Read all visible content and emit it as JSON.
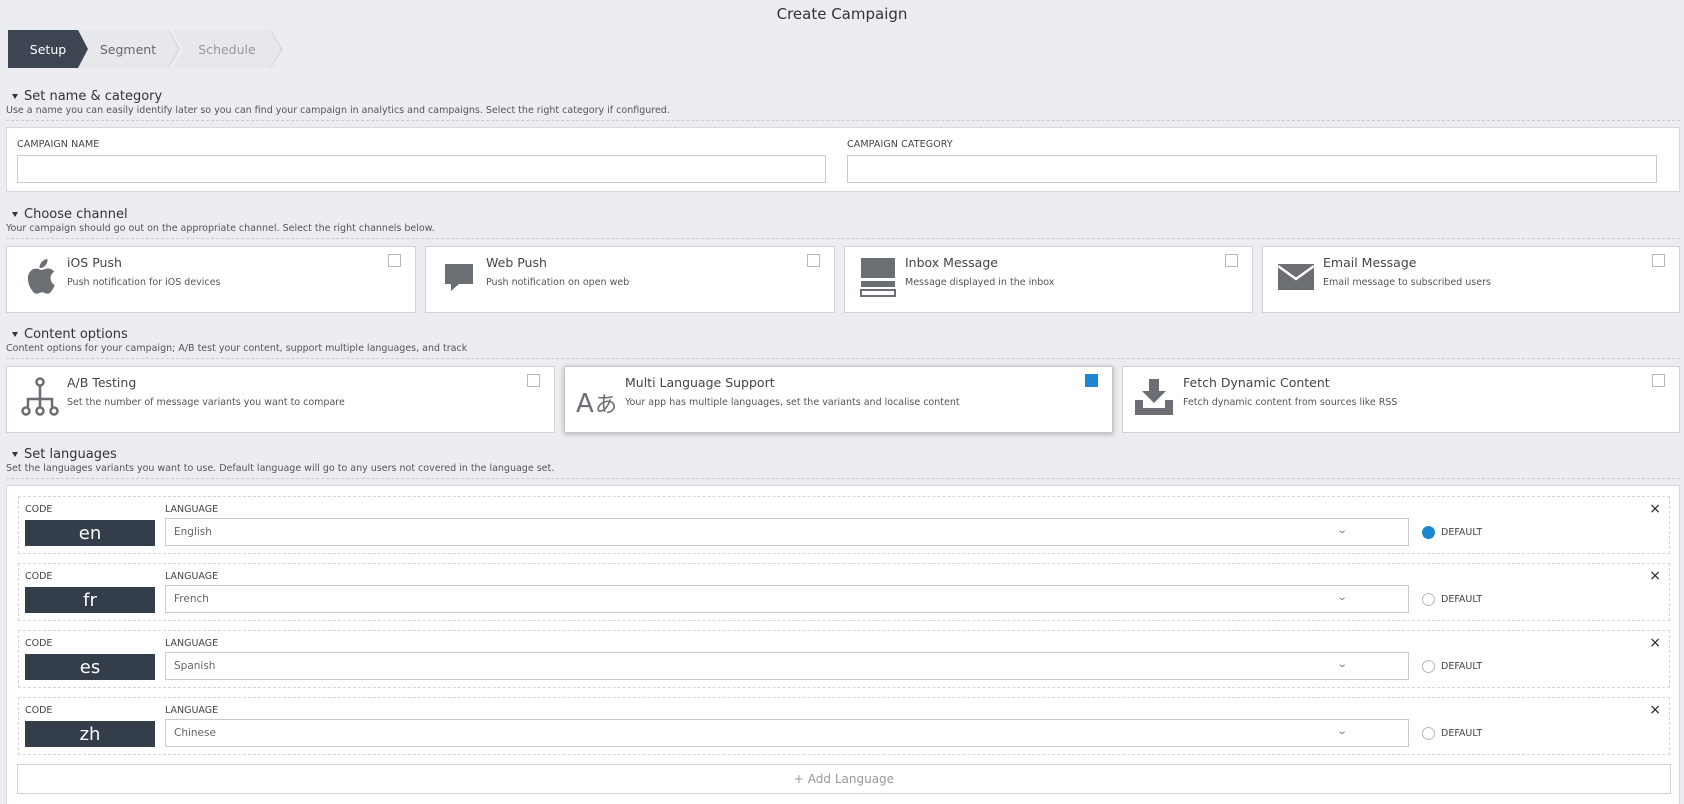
{
  "page": {
    "title": "Create Campaign"
  },
  "wizard": {
    "steps": [
      {
        "label": "Setup"
      },
      {
        "label": "Segment"
      },
      {
        "label": "Schedule"
      }
    ]
  },
  "sections": {
    "name": {
      "title": "Set name & category",
      "desc": "Use a name you can easily identify later so you can find your campaign in analytics and campaigns. Select the right category if configured.",
      "campaign_name_label": "CAMPAIGN NAME",
      "campaign_name_value": "",
      "campaign_category_label": "CAMPAIGN CATEGORY",
      "campaign_category_value": ""
    },
    "channel": {
      "title": "Choose channel",
      "desc": "Your campaign should go out on the appropriate channel. Select the right channels below.",
      "cards": [
        {
          "title": "iOS Push",
          "desc": "Push notification for iOS devices",
          "icon": "apple-icon",
          "checked": false
        },
        {
          "title": "Web Push",
          "desc": "Push notification on open web",
          "icon": "speech-bubble-icon",
          "checked": false
        },
        {
          "title": "Inbox Message",
          "desc": "Message displayed in the inbox",
          "icon": "inbox-icon",
          "checked": false
        },
        {
          "title": "Email Message",
          "desc": "Email message to subscribed users",
          "icon": "envelope-icon",
          "checked": false
        }
      ]
    },
    "content": {
      "title": "Content options",
      "desc": "Content options for your campaign; A/B test your content, support multiple languages, and track",
      "cards": [
        {
          "title": "A/B Testing",
          "desc": "Set the number of message variants you want to compare",
          "icon": "ab-tree-icon",
          "checked": false
        },
        {
          "title": "Multi Language Support",
          "desc": "Your app has multiple languages, set the variants and localise content",
          "icon": "language-icon",
          "checked": true
        },
        {
          "title": "Fetch Dynamic Content",
          "desc": "Fetch dynamic content from sources like RSS",
          "icon": "download-tray-icon",
          "checked": false
        }
      ]
    },
    "languages": {
      "title": "Set languages",
      "desc": "Set the languages variants you want to use. Default language will go to any users not covered in the language set.",
      "code_label": "CODE",
      "language_label": "LANGUAGE",
      "default_label": "DEFAULT",
      "close_glyph": "×",
      "rows": [
        {
          "code": "en",
          "language": "English",
          "default": true
        },
        {
          "code": "fr",
          "language": "French",
          "default": false
        },
        {
          "code": "es",
          "language": "Spanish",
          "default": false
        },
        {
          "code": "zh",
          "language": "Chinese",
          "default": false
        }
      ],
      "add_label": "+ Add Language"
    }
  },
  "colors": {
    "accent": "#1e87d4",
    "wizard_active": "#3d4552",
    "code_badge": "#343e4b",
    "background": "#ebedf0"
  }
}
